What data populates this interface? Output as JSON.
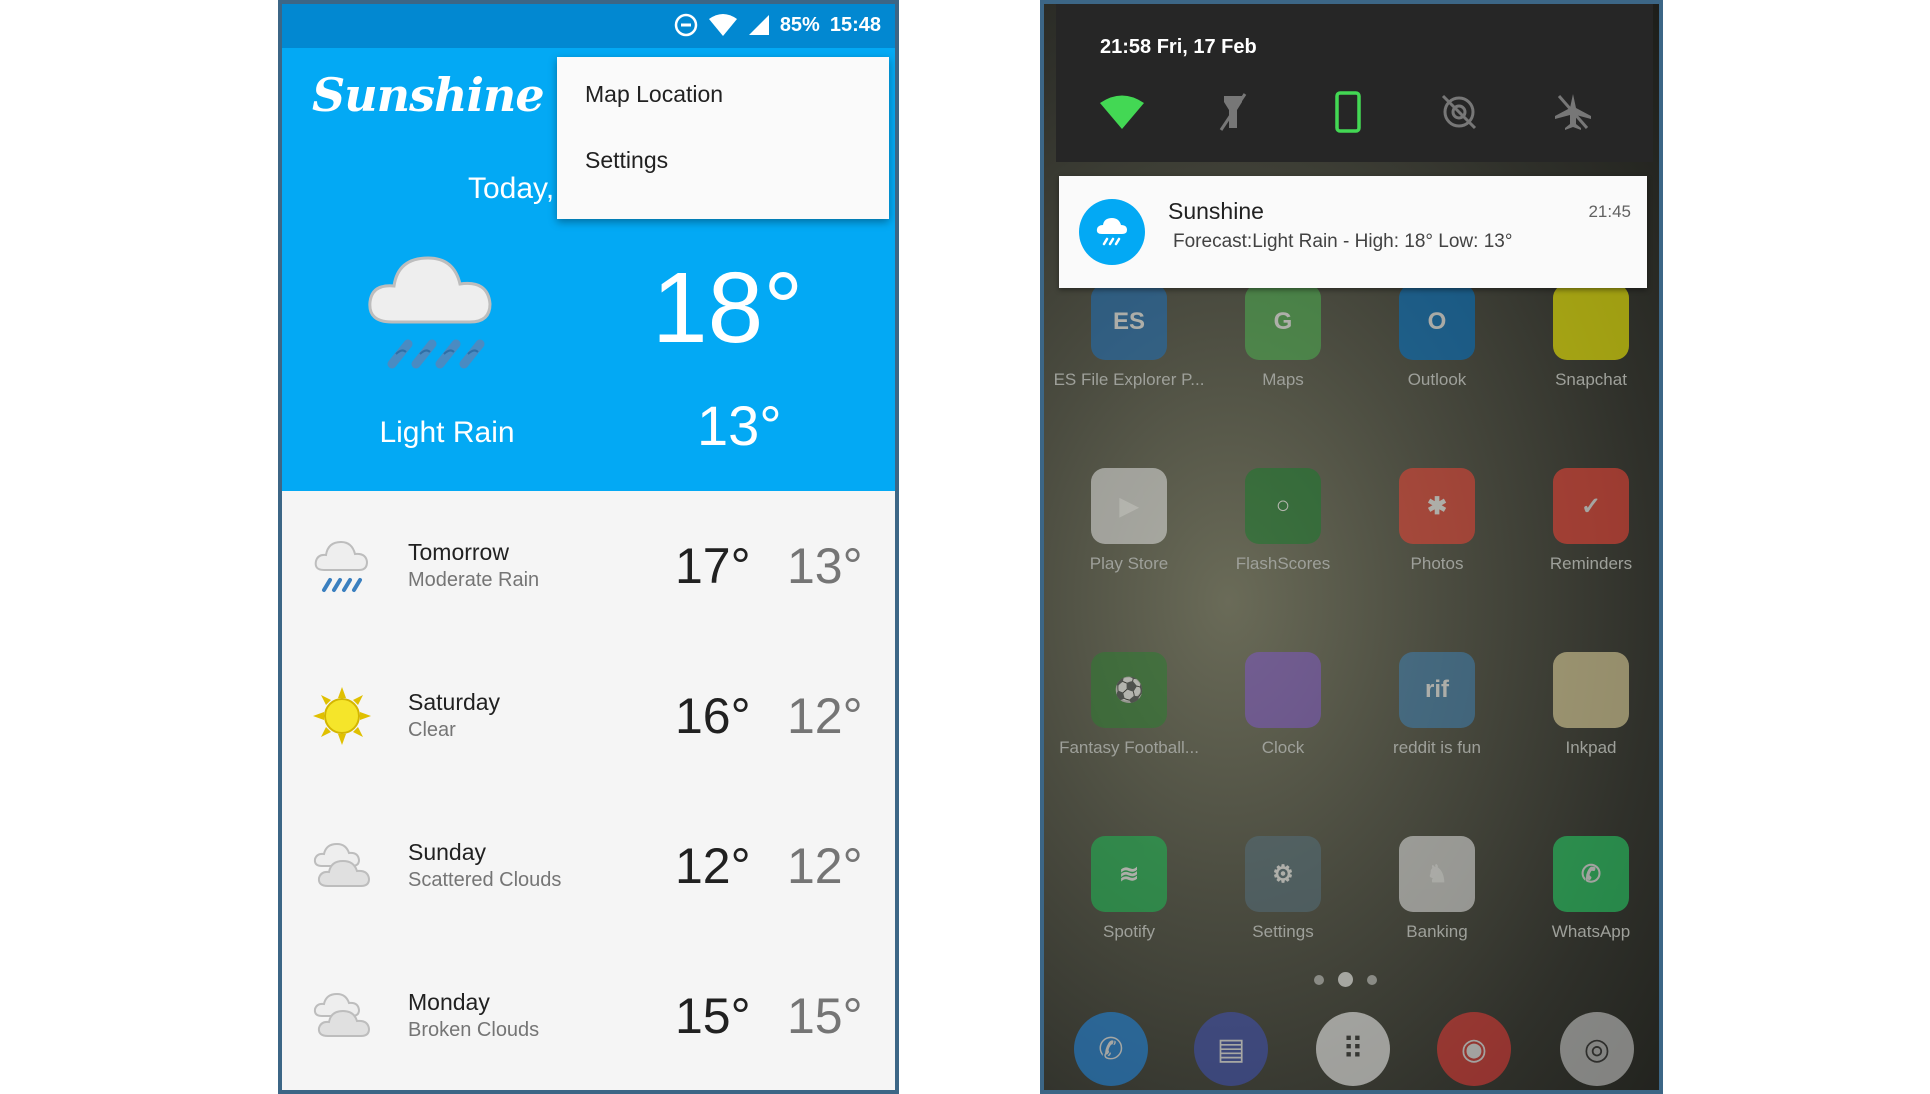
{
  "left_phone": {
    "status_bar": {
      "battery": "85%",
      "time": "15:48"
    },
    "app_logo": "Sunshine",
    "today": {
      "label": "Today,",
      "high": "18°",
      "low": "13°",
      "description": "Light Rain"
    },
    "menu": {
      "items": [
        "Map Location",
        "Settings"
      ]
    },
    "forecast": [
      {
        "day": "Tomorrow",
        "condition": "Moderate Rain",
        "high": "17°",
        "low": "13°",
        "icon": "rain-icon"
      },
      {
        "day": "Saturday",
        "condition": "Clear",
        "high": "16°",
        "low": "12°",
        "icon": "sun-icon"
      },
      {
        "day": "Sunday",
        "condition": "Scattered Clouds",
        "high": "12°",
        "low": "12°",
        "icon": "cloud-icon"
      },
      {
        "day": "Monday",
        "condition": "Broken Clouds",
        "high": "15°",
        "low": "15°",
        "icon": "cloud-icon"
      }
    ]
  },
  "right_phone": {
    "shade": {
      "datetime": "21:58  Fri, 17 Feb"
    },
    "notification": {
      "app": "Sunshine",
      "time": "21:45",
      "text": "Forecast:Light Rain - High: 18°  Low: 13°"
    },
    "apps": [
      {
        "label": "ES File Explorer P...",
        "color": "#1e6fb8",
        "glyph": "ES"
      },
      {
        "label": "Maps",
        "color": "#4caf50",
        "glyph": "G"
      },
      {
        "label": "Outlook",
        "color": "#0072c6",
        "glyph": "O"
      },
      {
        "label": "Snapchat",
        "color": "#fffc00",
        "glyph": ""
      },
      {
        "label": "Play Store",
        "color": "#e0e0e0",
        "glyph": "▶"
      },
      {
        "label": "FlashScores",
        "color": "#1b7a2e",
        "glyph": "○"
      },
      {
        "label": "Photos",
        "color": "#ea4335",
        "glyph": "✱"
      },
      {
        "label": "Reminders",
        "color": "#f44336",
        "glyph": "✓"
      },
      {
        "label": "Fantasy Football...",
        "color": "#2e7d32",
        "glyph": "⚽"
      },
      {
        "label": "Clock",
        "color": "#7e57c2",
        "glyph": ""
      },
      {
        "label": "reddit is fun",
        "color": "#3f7fb0",
        "glyph": "rif"
      },
      {
        "label": "Inkpad",
        "color": "#e8d9a0",
        "glyph": ""
      },
      {
        "label": "Spotify",
        "color": "#1db954",
        "glyph": "≋"
      },
      {
        "label": "Settings",
        "color": "#546e7a",
        "glyph": "⚙"
      },
      {
        "label": "Banking",
        "color": "#e0e0e0",
        "glyph": "♞"
      },
      {
        "label": "WhatsApp",
        "color": "#25d366",
        "glyph": "✆"
      }
    ],
    "dock": [
      {
        "name": "phone",
        "color": "#1e88e5",
        "glyph": "✆"
      },
      {
        "name": "messages",
        "color": "#3f51b5",
        "glyph": "▤"
      },
      {
        "name": "app-drawer",
        "color": "#f5f5f5",
        "glyph": "⠿"
      },
      {
        "name": "chrome",
        "color": "#e53935",
        "glyph": "◉"
      },
      {
        "name": "camera",
        "color": "#cfcfcf",
        "glyph": "◎"
      }
    ]
  }
}
